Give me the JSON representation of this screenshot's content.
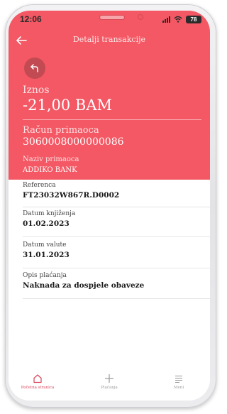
{
  "status_bar": {
    "time": "12:06",
    "battery": "78"
  },
  "header": {
    "title": "Detalji transakcije",
    "amount_label": "Iznos",
    "amount_value": "-21,00 BAM",
    "account_label": "Račun primaoca",
    "account_value": "3060008000000086",
    "recipient_label": "Naziv primaoca",
    "recipient_value": "ADDIKO BANK"
  },
  "details": [
    {
      "label": "Referenca",
      "value": "FT23032W867R.D0002"
    },
    {
      "label": "Datum knjiženja",
      "value": "01.02.2023"
    },
    {
      "label": "Datum valute",
      "value": "31.01.2023"
    },
    {
      "label": "Opis plaćanja",
      "value": "Naknada za dospjele obaveze"
    }
  ],
  "tab_bar": {
    "home": "Početna stranica",
    "payments": "Plaćanja",
    "menu": "Meni"
  },
  "colors": {
    "accent": "#f35864",
    "accent_dark": "#c24a52",
    "active_tab": "#d9465b"
  }
}
